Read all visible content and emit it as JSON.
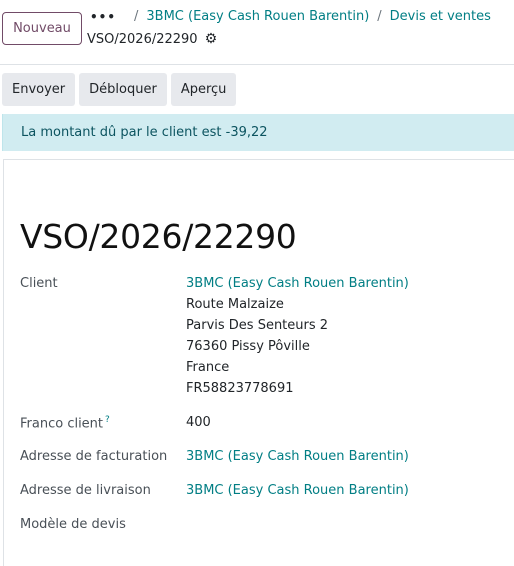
{
  "header": {
    "new_button": "Nouveau",
    "more_label": "•••",
    "breadcrumbs": [
      "3BMC (Easy Cash Rouen Barentin)",
      "Devis et ventes"
    ],
    "record_name": "VSO/2026/22290"
  },
  "actions": [
    "Envoyer",
    "Débloquer",
    "Aperçu"
  ],
  "alert": "La montant dû par le client est -39,22",
  "form": {
    "title": "VSO/2026/22290",
    "client_label": "Client",
    "client_name": "3BMC (Easy Cash Rouen Barentin)",
    "client_address": [
      "Route Malzaize",
      "Parvis Des Senteurs 2",
      "76360 Pissy Pôville",
      "France",
      "FR58823778691"
    ],
    "franco_label": "Franco client",
    "franco_help": "?",
    "franco_value": "400",
    "billing_label": "Adresse de facturation",
    "billing_value": "3BMC (Easy Cash Rouen Barentin)",
    "delivery_label": "Adresse de livraison",
    "delivery_value": "3BMC (Easy Cash Rouen Barentin)",
    "template_label": "Modèle de devis"
  },
  "colors": {
    "accent": "#714b67",
    "link": "#017e84",
    "alert_bg": "#d1ecf1"
  }
}
